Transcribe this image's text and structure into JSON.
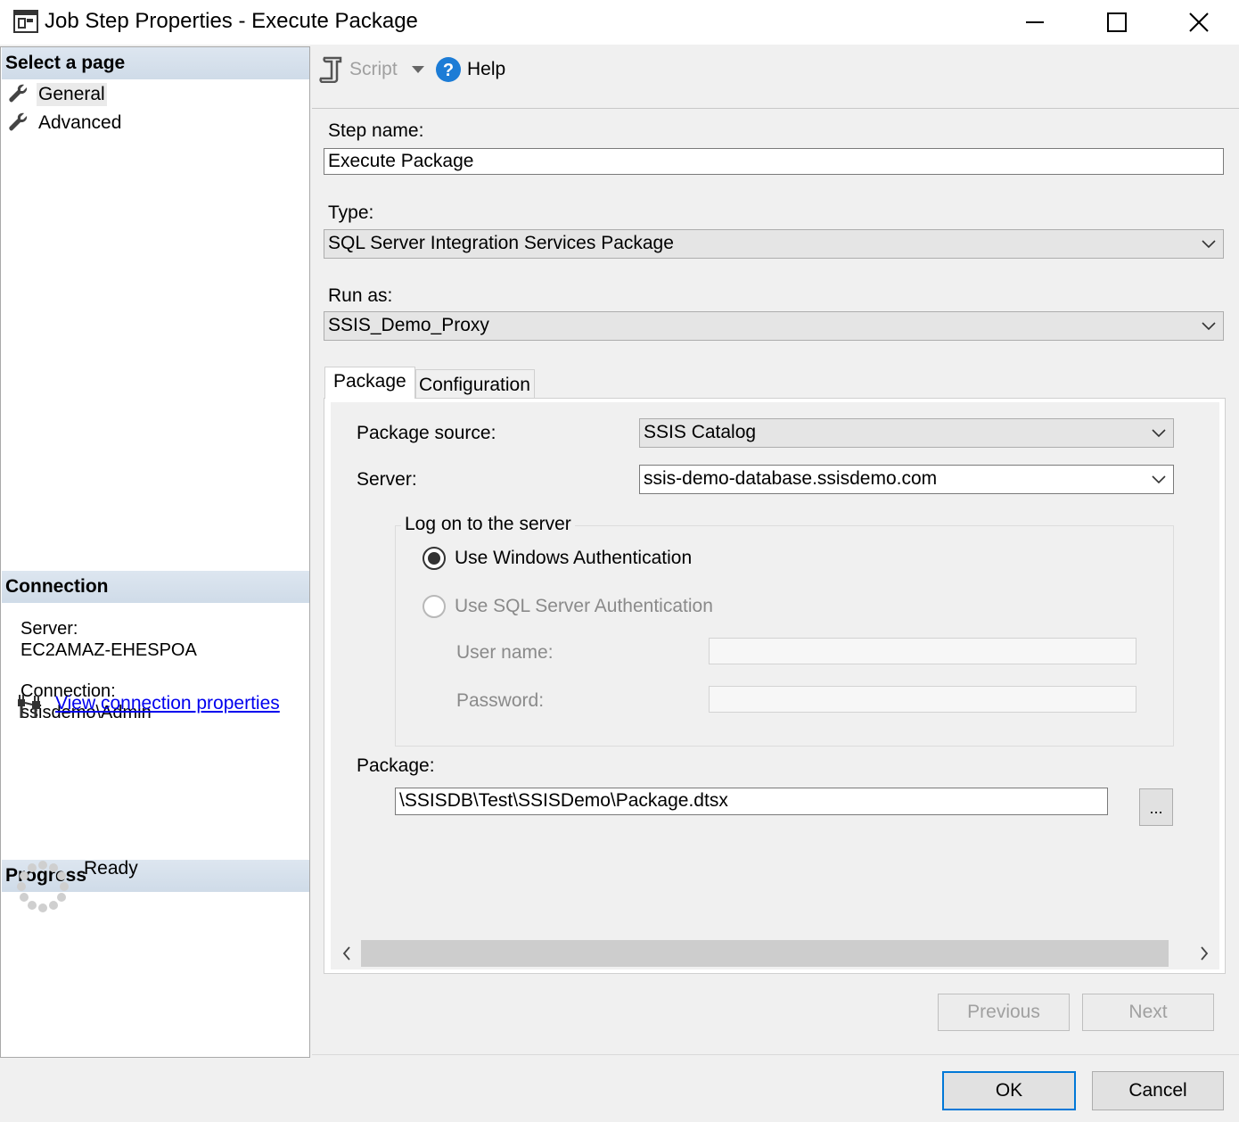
{
  "window": {
    "title": "Job Step Properties - Execute Package"
  },
  "sidebar": {
    "select_page_header": "Select a page",
    "pages": [
      {
        "label": "General",
        "selected": true
      },
      {
        "label": "Advanced",
        "selected": false
      }
    ],
    "connection_header": "Connection",
    "server_label": "Server:",
    "server_value": "EC2AMAZ-EHESPOA",
    "connection_label": "Connection:",
    "connection_value": "ssisdemo\\Admin",
    "view_connection_link": "View connection properties",
    "progress_header": "Progress",
    "progress_status": "Ready"
  },
  "toolbar": {
    "script_label": "Script",
    "help_label": "Help"
  },
  "form": {
    "step_name_label": "Step name:",
    "step_name_value": "Execute Package",
    "type_label": "Type:",
    "type_value": "SQL Server Integration Services Package",
    "run_as_label": "Run as:",
    "run_as_value": "SSIS_Demo_Proxy"
  },
  "tabs": [
    {
      "label": "Package",
      "active": true
    },
    {
      "label": "Configuration",
      "active": false
    }
  ],
  "package_tab": {
    "package_source_label": "Package source:",
    "package_source_value": "SSIS Catalog",
    "server_label": "Server:",
    "server_value": "ssis-demo-database.ssisdemo.com",
    "logon_group_label": "Log on to the server",
    "windows_auth_label": "Use Windows Authentication",
    "windows_auth_selected": true,
    "sql_auth_label": "Use SQL Server Authentication",
    "sql_auth_selected": false,
    "user_name_label": "User name:",
    "user_name_value": "",
    "password_label": "Password:",
    "password_value": "",
    "package_label": "Package:",
    "package_value": "\\SSISDB\\Test\\SSISDemo\\Package.dtsx",
    "browse_label": "..."
  },
  "navigation": {
    "previous_label": "Previous",
    "next_label": "Next"
  },
  "dialog_buttons": {
    "ok_label": "OK",
    "cancel_label": "Cancel"
  },
  "colors": {
    "link": "#0000ee",
    "header_band": "#d6e0eb",
    "ok_border": "#0078d7",
    "help_icon": "#1c7cd6"
  }
}
